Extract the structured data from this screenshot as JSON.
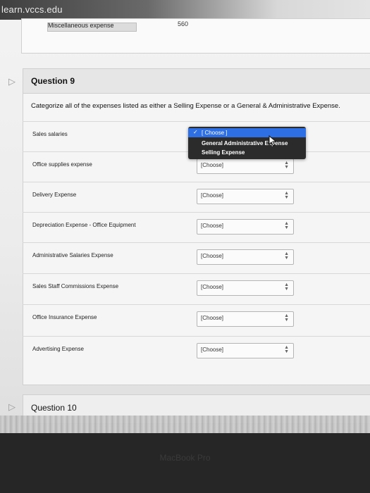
{
  "browser": {
    "url": "learn.vccs.edu"
  },
  "previous_question": {
    "label": "Miscellaneous expense",
    "amount": "560"
  },
  "question9": {
    "title": "Question 9",
    "instruction": "Categorize all of the expenses listed as either a Selling Expense or a General & Administrative Expense.",
    "rows": [
      {
        "label": "Sales salaries",
        "value": "[ Choose ]"
      },
      {
        "label": "Office supplies expense",
        "value": "[Choose]"
      },
      {
        "label": "Delivery Expense",
        "value": "[Choose]"
      },
      {
        "label": "Depreciation Expense - Office Equipment",
        "value": "[Choose]"
      },
      {
        "label": "Administrative Salaries Expense",
        "value": "[Choose]"
      },
      {
        "label": "Sales Staff Commissions Expense",
        "value": "[Choose]"
      },
      {
        "label": "Office Insurance Expense",
        "value": "[Choose]"
      },
      {
        "label": "Advertising Expense",
        "value": "[Choose]"
      }
    ],
    "dropdown": {
      "options": [
        "[ Choose ]",
        "General Administrative Expense",
        "Selling Expense"
      ],
      "selected_index": 0
    }
  },
  "question10": {
    "title": "Question 10"
  },
  "device": {
    "label": "MacBook Pro"
  }
}
